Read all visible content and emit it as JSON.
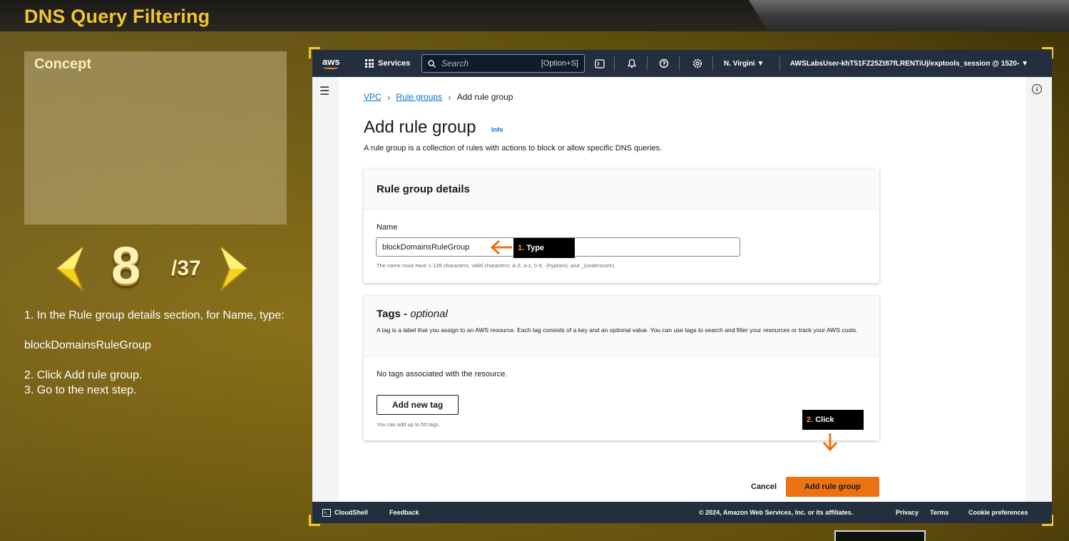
{
  "tutorial": {
    "title": "DNS Query Filtering",
    "concept_label": "Concept",
    "step_current": "8",
    "step_total": "/37",
    "instructions": {
      "line1": "1. In the Rule group details section, for Name, type:",
      "value": "blockDomainsRuleGroup",
      "line2": "2. Click Add rule group.",
      "line3": "3. Go to the next step."
    },
    "callout_type": {
      "num": "1.",
      "text": "Type"
    },
    "callout_click": {
      "num": "2.",
      "text": "Click"
    },
    "accent_color": "#f3c62c"
  },
  "topnav": {
    "logo": "aws",
    "services": "Services",
    "search_placeholder": "Search",
    "search_hint": "[Option+S]",
    "region": "N. Virgini ▼",
    "account": "AWSLabsUser-khT51FZ25Zt87fLRENTiUj/exptools_session @ 1520- ▼",
    "icons": [
      "cloudshell-icon",
      "notifications-icon",
      "help-icon",
      "settings-icon"
    ]
  },
  "breadcrumb": {
    "vpc": "VPC",
    "rule_groups": "Rule groups",
    "current": "Add rule group"
  },
  "page": {
    "title": "Add rule group",
    "info": "Info",
    "description": "A rule group is a collection of rules with actions to block or allow specific DNS queries."
  },
  "details": {
    "title": "Rule group details",
    "name_label": "Name",
    "name_value": "blockDomainsRuleGroup",
    "name_help": "The name must have 1-128 characters. Valid characters: A-Z, a-z, 0-9, -(hyphen), and _(underscore)."
  },
  "tags": {
    "title": "Tags - ",
    "optional": "optional",
    "description": "A tag is a label that you assign to an AWS resource. Each tag consists of a key and an optional value. You can use tags to search and filter your resources or track your AWS costs.",
    "empty": "No tags associated with the resource.",
    "add_button": "Add new tag",
    "help": "You can add up to 50 tags."
  },
  "actions": {
    "cancel": "Cancel",
    "submit": "Add rule group",
    "submit_color": "#ec7211"
  },
  "footer": {
    "cloudshell": "CloudShell",
    "feedback": "Feedback",
    "copyright": "© 2024, Amazon Web Services, Inc. or its affiliates.",
    "privacy": "Privacy",
    "terms": "Terms",
    "cookies": "Cookie preferences"
  }
}
